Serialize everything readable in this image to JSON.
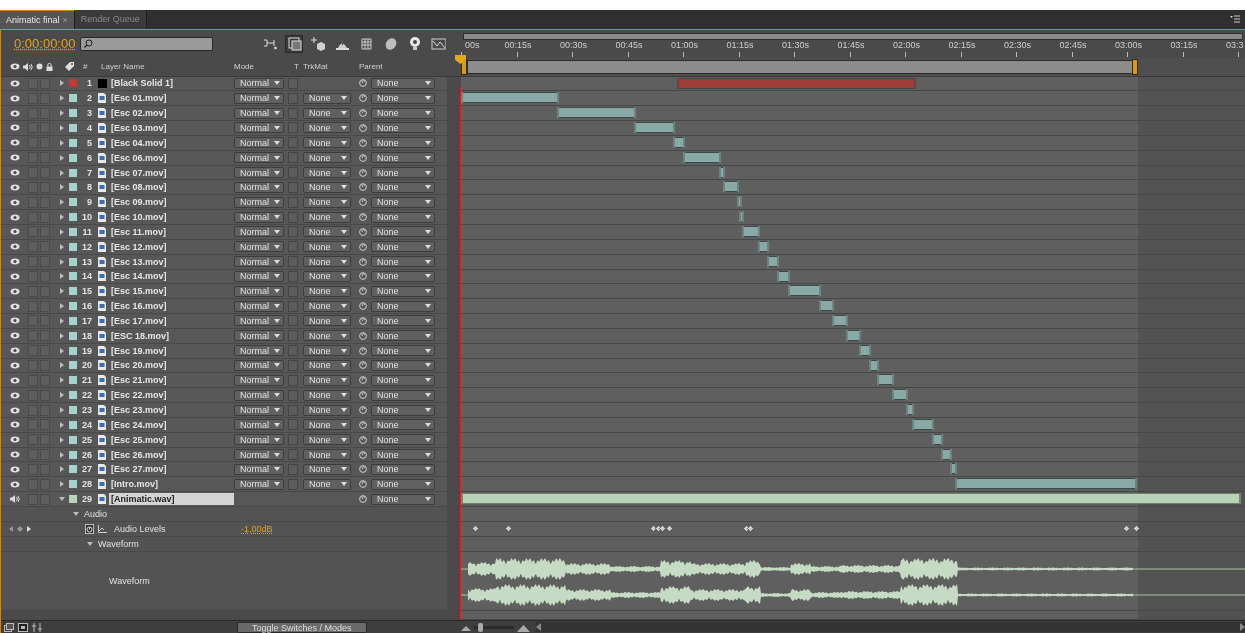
{
  "tabs": [
    {
      "label": "Animatic final",
      "close": "×",
      "selected": true
    },
    {
      "label": "Render Queue",
      "selected": false
    }
  ],
  "timecode": "0:00:00:00",
  "toolbar": [
    {
      "kind": "flow",
      "selected": false
    },
    {
      "kind": "frame",
      "selected": true
    },
    {
      "kind": "sparkle",
      "selected": false
    },
    {
      "kind": "ramp",
      "selected": false
    },
    {
      "kind": "grid",
      "selected": false
    },
    {
      "kind": "ball",
      "selected": false
    },
    {
      "kind": "bulb",
      "selected": false
    },
    {
      "kind": "graph",
      "selected": false
    }
  ],
  "columns": {
    "number": "#",
    "name": "Layer Name",
    "mode": "Mode",
    "t": "T",
    "trkmat": "TrkMat",
    "parent": "Parent"
  },
  "ruler": {
    "labels": [
      "00s",
      "00:15s",
      "00:30s",
      "00:45s",
      "01:00s",
      "01:15s",
      "01:30s",
      "01:45s",
      "02:00s",
      "02:15s",
      "02:30s",
      "02:45s",
      "03:00s",
      "03:15s",
      "03:3"
    ],
    "work_area": {
      "start": {
        "level": 0
      },
      "end": {
        "level": 0.862
      }
    }
  },
  "layers": [
    {
      "number": "1",
      "name": "[Black Solid 1]",
      "kind": "solid",
      "color": "#c23a36",
      "enabled": true,
      "solo": false,
      "locked": false,
      "transparency": false,
      "selected": false,
      "expanded": false,
      "mode": "Normal",
      "parent": "None",
      "in_point": {
        "level": 0.276
      },
      "out_point": {
        "level": 0.578
      }
    },
    {
      "number": "2",
      "name": "[Esc 01.mov]",
      "kind": "footage",
      "color": "#a6d2ce",
      "enabled": true,
      "solo": false,
      "locked": false,
      "transparency": false,
      "selected": false,
      "expanded": false,
      "mode": "Normal",
      "trkmat": "None",
      "parent": "None",
      "in_point": {
        "level": 0
      },
      "out_point": {
        "level": 0.123
      }
    },
    {
      "number": "3",
      "name": "[Esc 02.mov]",
      "kind": "footage",
      "color": "#a6d2ce",
      "enabled": true,
      "solo": false,
      "locked": false,
      "transparency": false,
      "selected": false,
      "expanded": false,
      "mode": "Normal",
      "trkmat": "None",
      "parent": "None",
      "in_point": {
        "level": 0.123
      },
      "out_point": {
        "level": 0.221
      }
    },
    {
      "number": "4",
      "name": "[Esc 03.mov]",
      "kind": "footage",
      "color": "#a6d2ce",
      "enabled": true,
      "solo": false,
      "locked": false,
      "transparency": false,
      "selected": false,
      "expanded": false,
      "mode": "Normal",
      "trkmat": "None",
      "parent": "None",
      "in_point": {
        "level": 0.221
      },
      "out_point": {
        "level": 0.271
      }
    },
    {
      "number": "5",
      "name": "[Esc 04.mov]",
      "kind": "footage",
      "color": "#a6d2ce",
      "enabled": true,
      "solo": false,
      "locked": false,
      "transparency": false,
      "selected": false,
      "expanded": false,
      "mode": "Normal",
      "trkmat": "None",
      "parent": "None",
      "in_point": {
        "level": 0.271
      },
      "out_point": {
        "level": 0.283
      }
    },
    {
      "number": "6",
      "name": "[Esc 06.mov]",
      "kind": "footage",
      "color": "#a6d2ce",
      "enabled": true,
      "solo": false,
      "locked": false,
      "transparency": false,
      "selected": false,
      "expanded": false,
      "mode": "Normal",
      "trkmat": "None",
      "parent": "None",
      "in_point": {
        "level": 0.283
      },
      "out_point": {
        "level": 0.33
      }
    },
    {
      "number": "7",
      "name": "[Esc 07.mov]",
      "kind": "footage",
      "color": "#a6d2ce",
      "enabled": true,
      "solo": false,
      "locked": false,
      "transparency": false,
      "selected": false,
      "expanded": false,
      "mode": "Normal",
      "trkmat": "None",
      "parent": "None",
      "in_point": {
        "level": 0.33
      },
      "out_point": {
        "level": 0.335
      }
    },
    {
      "number": "8",
      "name": "[Esc 08.mov]",
      "kind": "footage",
      "color": "#a6d2ce",
      "enabled": true,
      "solo": false,
      "locked": false,
      "transparency": false,
      "selected": false,
      "expanded": false,
      "mode": "Normal",
      "trkmat": "None",
      "parent": "None",
      "in_point": {
        "level": 0.335
      },
      "out_point": {
        "level": 0.352
      }
    },
    {
      "number": "9",
      "name": "[Esc 09.mov]",
      "kind": "footage",
      "color": "#a6d2ce",
      "enabled": true,
      "solo": false,
      "locked": false,
      "transparency": false,
      "selected": false,
      "expanded": false,
      "mode": "Normal",
      "trkmat": "None",
      "parent": "None",
      "in_point": {
        "level": 0.352
      },
      "out_point": {
        "level": 0.355
      }
    },
    {
      "number": "10",
      "name": "[Esc 10.mov]",
      "kind": "footage",
      "color": "#a6d2ce",
      "enabled": true,
      "solo": false,
      "locked": false,
      "transparency": false,
      "selected": false,
      "expanded": false,
      "mode": "Normal",
      "trkmat": "None",
      "parent": "None",
      "in_point": {
        "level": 0.355
      },
      "out_point": {
        "level": 0.359
      }
    },
    {
      "number": "11",
      "name": "[Esc 11.mov]",
      "kind": "footage",
      "color": "#a6d2ce",
      "enabled": true,
      "solo": false,
      "locked": false,
      "transparency": false,
      "selected": false,
      "expanded": false,
      "mode": "Normal",
      "trkmat": "None",
      "parent": "None",
      "in_point": {
        "level": 0.359
      },
      "out_point": {
        "level": 0.379
      }
    },
    {
      "number": "12",
      "name": "[Esc 12.mov]",
      "kind": "footage",
      "color": "#a6d2ce",
      "enabled": true,
      "solo": false,
      "locked": false,
      "transparency": false,
      "selected": false,
      "expanded": false,
      "mode": "Normal",
      "trkmat": "None",
      "parent": "None",
      "in_point": {
        "level": 0.379
      },
      "out_point": {
        "level": 0.391
      }
    },
    {
      "number": "13",
      "name": "[Esc 13.mov]",
      "kind": "footage",
      "color": "#a6d2ce",
      "enabled": true,
      "solo": false,
      "locked": false,
      "transparency": false,
      "selected": false,
      "expanded": false,
      "mode": "Normal",
      "trkmat": "None",
      "parent": "None",
      "in_point": {
        "level": 0.391
      },
      "out_point": {
        "level": 0.404
      }
    },
    {
      "number": "14",
      "name": "[Esc 14.mov]",
      "kind": "footage",
      "color": "#a6d2ce",
      "enabled": true,
      "solo": false,
      "locked": false,
      "transparency": false,
      "selected": false,
      "expanded": false,
      "mode": "Normal",
      "trkmat": "None",
      "parent": "None",
      "in_point": {
        "level": 0.404
      },
      "out_point": {
        "level": 0.418
      }
    },
    {
      "number": "15",
      "name": "[Esc 15.mov]",
      "kind": "footage",
      "color": "#a6d2ce",
      "enabled": true,
      "solo": false,
      "locked": false,
      "transparency": false,
      "selected": false,
      "expanded": false,
      "mode": "Normal",
      "trkmat": "None",
      "parent": "None",
      "in_point": {
        "level": 0.418
      },
      "out_point": {
        "level": 0.457
      }
    },
    {
      "number": "16",
      "name": "[Esc 16.mov]",
      "kind": "footage",
      "color": "#a6d2ce",
      "enabled": true,
      "solo": false,
      "locked": false,
      "transparency": false,
      "selected": false,
      "expanded": false,
      "mode": "Normal",
      "trkmat": "None",
      "parent": "None",
      "in_point": {
        "level": 0.457
      },
      "out_point": {
        "level": 0.474
      }
    },
    {
      "number": "17",
      "name": "[Esc 17.mov]",
      "kind": "footage",
      "color": "#a6d2ce",
      "enabled": true,
      "solo": false,
      "locked": false,
      "transparency": false,
      "selected": false,
      "expanded": false,
      "mode": "Normal",
      "trkmat": "None",
      "parent": "None",
      "in_point": {
        "level": 0.474
      },
      "out_point": {
        "level": 0.492
      }
    },
    {
      "number": "18",
      "name": "[ESC 18.mov]",
      "kind": "footage",
      "color": "#a6d2ce",
      "enabled": true,
      "solo": false,
      "locked": false,
      "transparency": false,
      "selected": false,
      "expanded": false,
      "mode": "Normal",
      "trkmat": "None",
      "parent": "None",
      "in_point": {
        "level": 0.492
      },
      "out_point": {
        "level": 0.508
      }
    },
    {
      "number": "19",
      "name": "[Esc 19.mov]",
      "kind": "footage",
      "color": "#a6d2ce",
      "enabled": true,
      "solo": false,
      "locked": false,
      "transparency": false,
      "selected": false,
      "expanded": false,
      "mode": "Normal",
      "trkmat": "None",
      "parent": "None",
      "in_point": {
        "level": 0.508
      },
      "out_point": {
        "level": 0.521
      }
    },
    {
      "number": "20",
      "name": "[Esc 20.mov]",
      "kind": "footage",
      "color": "#a6d2ce",
      "enabled": true,
      "solo": false,
      "locked": false,
      "transparency": false,
      "selected": false,
      "expanded": false,
      "mode": "Normal",
      "trkmat": "None",
      "parent": "None",
      "in_point": {
        "level": 0.521
      },
      "out_point": {
        "level": 0.531
      }
    },
    {
      "number": "21",
      "name": "[Esc 21.mov]",
      "kind": "footage",
      "color": "#a6d2ce",
      "enabled": true,
      "solo": false,
      "locked": false,
      "transparency": false,
      "selected": false,
      "expanded": false,
      "mode": "Normal",
      "trkmat": "None",
      "parent": "None",
      "in_point": {
        "level": 0.531
      },
      "out_point": {
        "level": 0.551
      }
    },
    {
      "number": "22",
      "name": "[Esc 22.mov]",
      "kind": "footage",
      "color": "#a6d2ce",
      "enabled": true,
      "solo": false,
      "locked": false,
      "transparency": false,
      "selected": false,
      "expanded": false,
      "mode": "Normal",
      "trkmat": "None",
      "parent": "None",
      "in_point": {
        "level": 0.551
      },
      "out_point": {
        "level": 0.568
      }
    },
    {
      "number": "23",
      "name": "[Esc 23.mov]",
      "kind": "footage",
      "color": "#a6d2ce",
      "enabled": true,
      "solo": false,
      "locked": false,
      "transparency": false,
      "selected": false,
      "expanded": false,
      "mode": "Normal",
      "trkmat": "None",
      "parent": "None",
      "in_point": {
        "level": 0.568
      },
      "out_point": {
        "level": 0.576
      }
    },
    {
      "number": "24",
      "name": "[Esc 24.mov]",
      "kind": "footage",
      "color": "#a6d2ce",
      "enabled": true,
      "solo": false,
      "locked": false,
      "transparency": false,
      "selected": false,
      "expanded": false,
      "mode": "Normal",
      "trkmat": "None",
      "parent": "None",
      "in_point": {
        "level": 0.576
      },
      "out_point": {
        "level": 0.601
      }
    },
    {
      "number": "25",
      "name": "[Esc 25.mov]",
      "kind": "footage",
      "color": "#a6d2ce",
      "enabled": true,
      "solo": false,
      "locked": false,
      "transparency": false,
      "selected": false,
      "expanded": false,
      "mode": "Normal",
      "trkmat": "None",
      "parent": "None",
      "in_point": {
        "level": 0.601
      },
      "out_point": {
        "level": 0.613
      }
    },
    {
      "number": "26",
      "name": "[Esc 26.mov]",
      "kind": "footage",
      "color": "#a6d2ce",
      "enabled": true,
      "solo": false,
      "locked": false,
      "transparency": false,
      "selected": false,
      "expanded": false,
      "mode": "Normal",
      "trkmat": "None",
      "parent": "None",
      "in_point": {
        "level": 0.613
      },
      "out_point": {
        "level": 0.624
      }
    },
    {
      "number": "27",
      "name": "[Esc 27.mov]",
      "kind": "footage",
      "color": "#a6d2ce",
      "enabled": true,
      "solo": false,
      "locked": false,
      "transparency": false,
      "selected": false,
      "expanded": false,
      "mode": "Normal",
      "trkmat": "None",
      "parent": "None",
      "in_point": {
        "level": 0.624
      },
      "out_point": {
        "level": 0.631
      }
    },
    {
      "number": "28",
      "name": "[Intro.mov]",
      "kind": "footage",
      "color": "#a6d2ce",
      "enabled": true,
      "solo": false,
      "locked": false,
      "transparency": false,
      "selected": false,
      "expanded": false,
      "mode": "Normal",
      "trkmat": "None",
      "parent": "None",
      "in_point": {
        "level": 0.631
      },
      "out_point": {
        "level": 0.861
      }
    },
    {
      "number": "29",
      "name": "[Animatic.wav]",
      "kind": "audio",
      "color": "#b8d4b8",
      "enabled": true,
      "solo": false,
      "locked": false,
      "selected": true,
      "expanded": true,
      "parent": "None",
      "in_point": {
        "level": 0
      },
      "out_point": {
        "level": 0.994
      }
    }
  ],
  "properties": [
    {
      "kind": "group",
      "label": "Audio",
      "expanded": true,
      "children": [
        {
          "kind": "property",
          "label": "Audio Levels",
          "value": "-1,00dB",
          "keyframes": [
            {
              "level": 0.019
            },
            {
              "level": 0.061
            },
            {
              "level": 0.245
            },
            {
              "level": 0.252
            },
            {
              "level": 0.257
            },
            {
              "level": 0.265
            },
            {
              "level": 0.364
            },
            {
              "level": 0.369
            },
            {
              "level": 0.848
            },
            {
              "level": 0.86
            }
          ]
        },
        {
          "kind": "group",
          "label": "Waveform",
          "expanded": true,
          "children": [
            {
              "kind": "waveform",
              "label": "Waveform"
            }
          ]
        }
      ]
    }
  ],
  "footer": {
    "button": "Toggle Switches / Modes",
    "zoom": {
      "level": 0.1
    }
  }
}
